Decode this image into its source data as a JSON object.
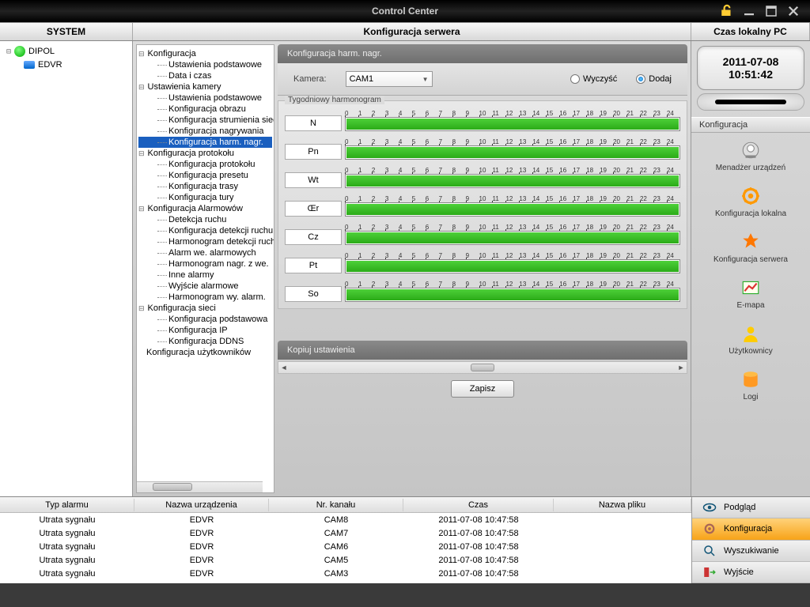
{
  "titlebar": {
    "title": "Control Center"
  },
  "header": {
    "left": "SYSTEM",
    "mid": "Konfiguracja serwera",
    "right": "Czas lokalny PC"
  },
  "devices": {
    "root": "DIPOL",
    "child": "EDVR"
  },
  "config_tree": [
    {
      "label": "Konfiguracja",
      "group": true
    },
    {
      "label": "Ustawienia podstawowe",
      "sub": true
    },
    {
      "label": "Data i czas",
      "sub": true
    },
    {
      "label": "Ustawienia kamery",
      "group": true
    },
    {
      "label": "Ustawienia podstawowe",
      "sub": true
    },
    {
      "label": "Konfiguracja obrazu",
      "sub": true
    },
    {
      "label": "Konfiguracja strumienia sieciowego",
      "sub": true
    },
    {
      "label": "Konfiguracja nagrywania",
      "sub": true
    },
    {
      "label": "Konfiguracja harm. nagr.",
      "sub": true,
      "selected": true
    },
    {
      "label": "Konfiguracja protokołu",
      "group": true
    },
    {
      "label": "Konfiguracja protokołu",
      "sub": true
    },
    {
      "label": "Konfiguracja presetu",
      "sub": true
    },
    {
      "label": "Konfiguracja trasy",
      "sub": true
    },
    {
      "label": "Konfiguracja tury",
      "sub": true
    },
    {
      "label": "Konfiguracja Alarmowów",
      "group": true
    },
    {
      "label": "Detekcja ruchu",
      "sub": true
    },
    {
      "label": "Konfiguracja detekcji ruchu",
      "sub": true
    },
    {
      "label": "Harmonogram detekcji ruchu",
      "sub": true
    },
    {
      "label": "Alarm we. alarmowych",
      "sub": true
    },
    {
      "label": "Harmonogram nagr. z we.",
      "sub": true
    },
    {
      "label": "Inne alarmy",
      "sub": true
    },
    {
      "label": "Wyjście alarmowe",
      "sub": true
    },
    {
      "label": "Harmonogram wy. alarm.",
      "sub": true
    },
    {
      "label": "Konfiguracja sieci",
      "group": true
    },
    {
      "label": "Konfiguracja podstawowa",
      "sub": true
    },
    {
      "label": "Konfiguracja IP",
      "sub": true
    },
    {
      "label": "Konfiguracja DDNS",
      "sub": true
    },
    {
      "label": "Konfiguracja użytkowników",
      "group": false
    }
  ],
  "section": {
    "title": "Konfiguracja harm. nagr.",
    "camera_label": "Kamera:",
    "camera_value": "CAM1",
    "clear_label": "Wyczyść",
    "add_label": "Dodaj"
  },
  "schedule": {
    "title": "Tygodniowy harmonogram",
    "hours": [
      "0",
      "1",
      "2",
      "3",
      "4",
      "5",
      "6",
      "7",
      "8",
      "9",
      "10",
      "11",
      "12",
      "13",
      "14",
      "15",
      "16",
      "17",
      "18",
      "19",
      "20",
      "21",
      "22",
      "23",
      "24"
    ],
    "days": [
      "N",
      "Pn",
      "Wt",
      "Œr",
      "Cz",
      "Pt",
      "So"
    ]
  },
  "copy_title": "Kopiuj ustawienia",
  "save_label": "Zapisz",
  "clock": {
    "date": "2011-07-08",
    "time": "10:51:42"
  },
  "rp_section": "Konfiguracja",
  "rp_items": [
    {
      "name": "device-manager",
      "label": "Menadżer urządzeń"
    },
    {
      "name": "local-config",
      "label": "Konfiguracja lokalna"
    },
    {
      "name": "server-config",
      "label": "Konfiguracja serwera"
    },
    {
      "name": "emap",
      "label": "E-mapa"
    },
    {
      "name": "users",
      "label": "Użytkownicy"
    },
    {
      "name": "logs",
      "label": "Logi"
    }
  ],
  "log": {
    "headers": [
      "Typ alarmu",
      "Nazwa urządzenia",
      "Nr. kanału",
      "Czas",
      "Nazwa pliku"
    ],
    "rows": [
      [
        "Utrata sygnału",
        "EDVR",
        "CAM8",
        "2011-07-08 10:47:58",
        ""
      ],
      [
        "Utrata sygnału",
        "EDVR",
        "CAM7",
        "2011-07-08 10:47:58",
        ""
      ],
      [
        "Utrata sygnału",
        "EDVR",
        "CAM6",
        "2011-07-08 10:47:58",
        ""
      ],
      [
        "Utrata sygnału",
        "EDVR",
        "CAM5",
        "2011-07-08 10:47:58",
        ""
      ],
      [
        "Utrata sygnału",
        "EDVR",
        "CAM3",
        "2011-07-08 10:47:58",
        ""
      ]
    ]
  },
  "bottom_nav": [
    {
      "name": "preview",
      "label": "Podgląd"
    },
    {
      "name": "config",
      "label": "Konfiguracja",
      "active": true
    },
    {
      "name": "search",
      "label": "Wyszukiwanie"
    },
    {
      "name": "exit",
      "label": "Wyjście"
    }
  ]
}
